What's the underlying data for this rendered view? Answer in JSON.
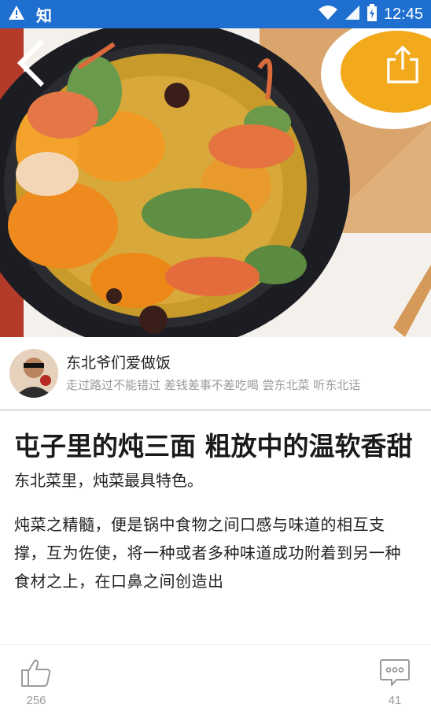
{
  "status_bar": {
    "app_label": "知",
    "time": "12:45",
    "icons": [
      "warning-icon",
      "wifi-icon",
      "signal-icon",
      "battery-icon"
    ]
  },
  "hero": {
    "image_desc": "dish-photo",
    "back_icon": "back-arrow-icon",
    "share_icon": "share-icon"
  },
  "author": {
    "name": "东北爷们爱做饭",
    "description": "走过路过不能错过 差钱差事不差吃喝 尝东北菜 听东北话"
  },
  "article": {
    "title": "屯子里的炖三面 粗放中的温软香甜",
    "subtitle": "东北菜里，炖菜最具特色。",
    "body": "炖菜之精髓，便是锅中食物之间口感与味道的相互支撑，互为佐使，将一种或者多种味道成功附着到另一种食材之上，在口鼻之间创造出"
  },
  "actions": {
    "like_count": "256",
    "comment_count": "41"
  },
  "colors": {
    "status_bar": "#1e6fd0",
    "muted_text": "#9a9a9a"
  }
}
